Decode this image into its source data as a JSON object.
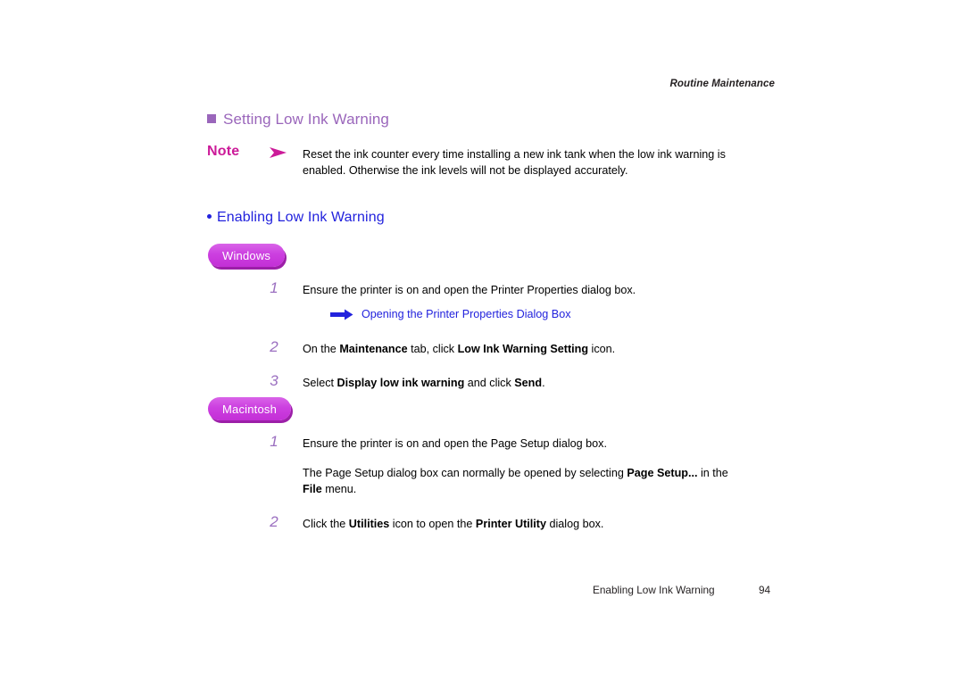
{
  "header": {
    "running_title": "Routine Maintenance"
  },
  "section": {
    "title": "Setting Low Ink Warning"
  },
  "note": {
    "label": "Note",
    "arrow_icon": "arrowhead-right-icon",
    "body": "Reset the ink counter every time installing a new ink tank when the low ink warning is enabled.  Otherwise the ink levels will not be displayed accurately."
  },
  "subsection": {
    "title": "Enabling Low Ink Warning"
  },
  "windows": {
    "badge_label": "Windows",
    "steps": [
      {
        "number": "1",
        "text_before": "Ensure the printer is on and open the Printer Properties dialog box.",
        "bold": "",
        "text_after": ""
      },
      {
        "number": "2",
        "text_before": "On the ",
        "bold": "Maintenance",
        "text_mid": " tab, click ",
        "bold2": "Low Ink Warning Setting",
        "text_after": " icon."
      },
      {
        "number": "3",
        "text_before": "Select ",
        "bold": "Display low ink warning",
        "text_mid": " and click ",
        "bold2": "Send",
        "text_after": "."
      }
    ],
    "xref": {
      "icon": "block-arrow-right-icon",
      "label": "Opening the Printer Properties Dialog Box"
    }
  },
  "macintosh": {
    "badge_label": "Macintosh",
    "steps": [
      {
        "number": "1",
        "text_before": "Ensure the printer is on and open the Page Setup dialog box.",
        "bold": "",
        "text_after": ""
      },
      {
        "number": "2",
        "text_before": "Click the ",
        "bold": "Utilities",
        "text_mid": " icon to open the ",
        "bold2": "Printer Utility",
        "text_after": " dialog box."
      }
    ],
    "note_paragraph": {
      "text_before": "The Page Setup dialog box can normally be opened by selecting ",
      "bold": "Page Setup...",
      "text_mid": " in the ",
      "bold2": "File",
      "text_after": " menu."
    }
  },
  "footer": {
    "title": "Enabling Low Ink Warning",
    "page_number": "94"
  },
  "colors": {
    "section_heading": "#9a66bb",
    "sub_heading": "#2222dd",
    "note_label": "#cc1b99",
    "step_number": "#9b6fc0",
    "badge_fill": "#cc3fe0",
    "badge_shadow": "#9c1fa8",
    "link": "#2222dd"
  }
}
